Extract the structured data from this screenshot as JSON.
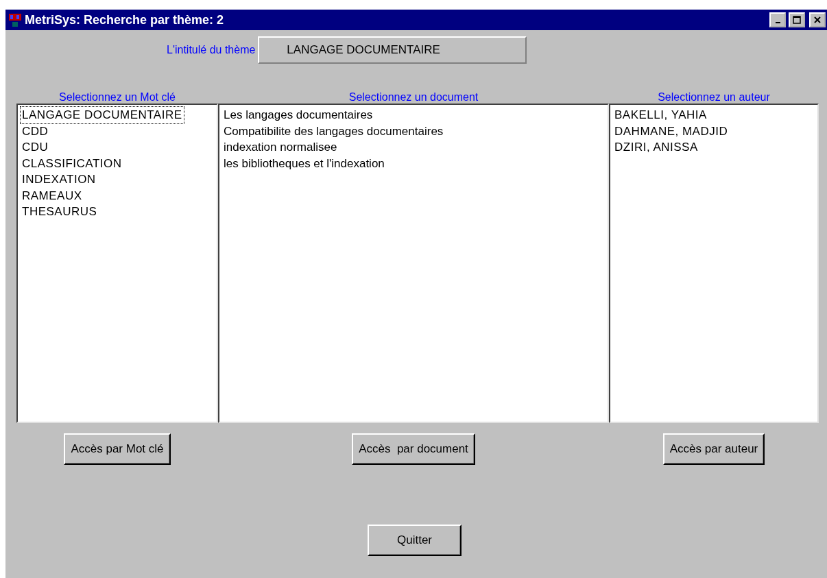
{
  "window": {
    "title": "MetriSys: Recherche par thème: 2"
  },
  "theme": {
    "label": "L'intitulé du thème",
    "value": "LANGAGE DOCUMENTAIRE"
  },
  "lists": [
    {
      "heading": "Selectionnez un Mot clé",
      "kind": "caps",
      "items": [
        {
          "text": "LANGAGE DOCUMENTAIRE",
          "focused": true
        },
        {
          "text": "CDD",
          "focused": false
        },
        {
          "text": "CDU",
          "focused": false
        },
        {
          "text": "CLASSIFICATION",
          "focused": false
        },
        {
          "text": "INDEXATION",
          "focused": false
        },
        {
          "text": "RAMEAUX",
          "focused": false
        },
        {
          "text": "THESAURUS",
          "focused": false
        }
      ],
      "button": "Accès par Mot clé"
    },
    {
      "heading": "Selectionnez un document",
      "kind": "normal",
      "items": [
        {
          "text": "Les langages documentaires",
          "focused": false
        },
        {
          "text": "Compatibilite des langages documentaires",
          "focused": false
        },
        {
          "text": "indexation normalisee",
          "focused": false
        },
        {
          "text": "les bibliotheques et l'indexation",
          "focused": false
        }
      ],
      "button": "Accès  par document"
    },
    {
      "heading": "Selectionnez un auteur",
      "kind": "caps",
      "items": [
        {
          "text": "BAKELLI, YAHIA",
          "focused": false
        },
        {
          "text": "DAHMANE, MADJID",
          "focused": false
        },
        {
          "text": "DZIRI, ANISSA",
          "focused": false
        }
      ],
      "button": "Accès par auteur"
    }
  ],
  "quit_button": "Quitter"
}
